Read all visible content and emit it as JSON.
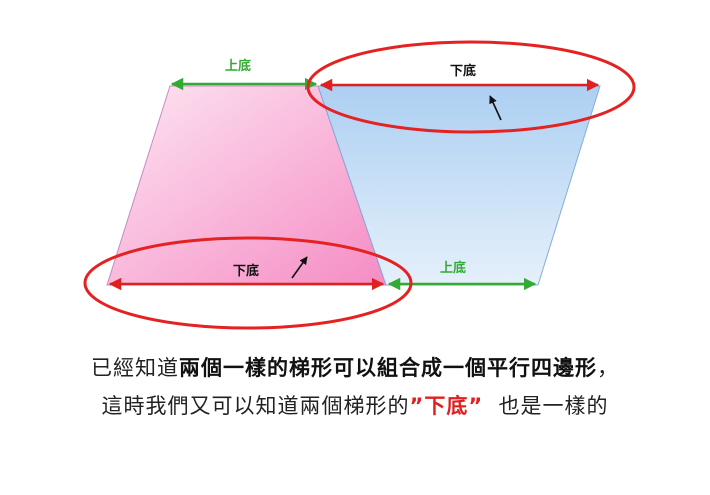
{
  "diagram": {
    "pink_top_label": "上底",
    "pink_bottom_label": "下底",
    "blue_top_label": "下底",
    "blue_bottom_label": "上底"
  },
  "caption": {
    "line1_prefix": "已經知道",
    "line1_bold": "兩個一樣的梯形可以組合成一個平行四邊形",
    "line1_suffix": "，",
    "line2_prefix": "這時我們又可以知道兩個梯形的",
    "line2_highlight": "”下底”",
    "line2_suffix": "也是一樣的"
  },
  "colors": {
    "pink_fill": "#f7a8d2",
    "blue_fill": "#bcd9f5",
    "green_arrow": "#33aa33",
    "red_arrow": "#e02020",
    "ellipse": "#e42222"
  }
}
